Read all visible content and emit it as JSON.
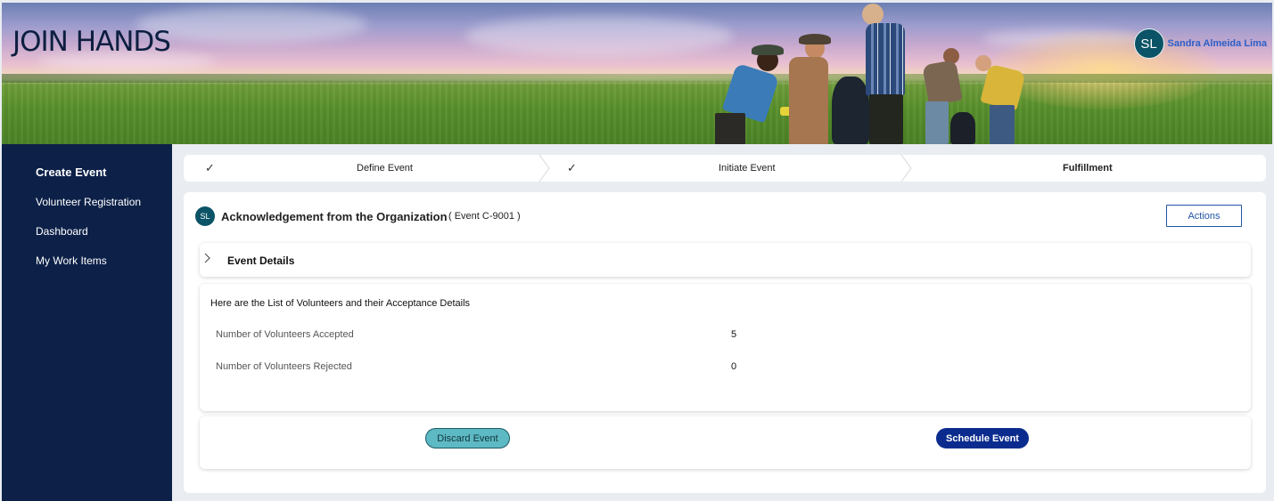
{
  "header": {
    "brand": "JOIN HANDS",
    "user": {
      "initials": "SL",
      "name": "Sandra Almeida Lima"
    }
  },
  "sidebar": {
    "items": [
      {
        "label": "Create Event",
        "active": true
      },
      {
        "label": "Volunteer Registration",
        "active": false
      },
      {
        "label": "Dashboard",
        "active": false
      },
      {
        "label": "My Work Items",
        "active": false
      }
    ]
  },
  "stepper": {
    "steps": [
      {
        "label": "Define Event",
        "status": "done",
        "icon": "check-icon"
      },
      {
        "label": "Initiate Event",
        "status": "done",
        "icon": "check-icon"
      },
      {
        "label": "Fulfillment",
        "status": "current"
      }
    ]
  },
  "case": {
    "avatar": "SL",
    "title": "Acknowledgement from the Organization",
    "id_text": "( Event  C-9001 )",
    "actions_label": "Actions"
  },
  "event_details": {
    "title": "Event Details",
    "icon": "chevron-right-icon",
    "expanded": false
  },
  "volunteers": {
    "heading": "Here are the List of Volunteers and their Acceptance Details",
    "rows": [
      {
        "label": "Number of Volunteers Accepted",
        "value": "5"
      },
      {
        "label": "Number of Volunteers Rejected",
        "value": "0"
      }
    ]
  },
  "buttons": {
    "discard": "Discard Event",
    "schedule": "Schedule Event"
  },
  "colors": {
    "sidebar": "#0d2148",
    "accent": "#0b2c8e",
    "teal": "#5db9c3",
    "avatar": "#0b5366",
    "link": "#2156a8"
  }
}
